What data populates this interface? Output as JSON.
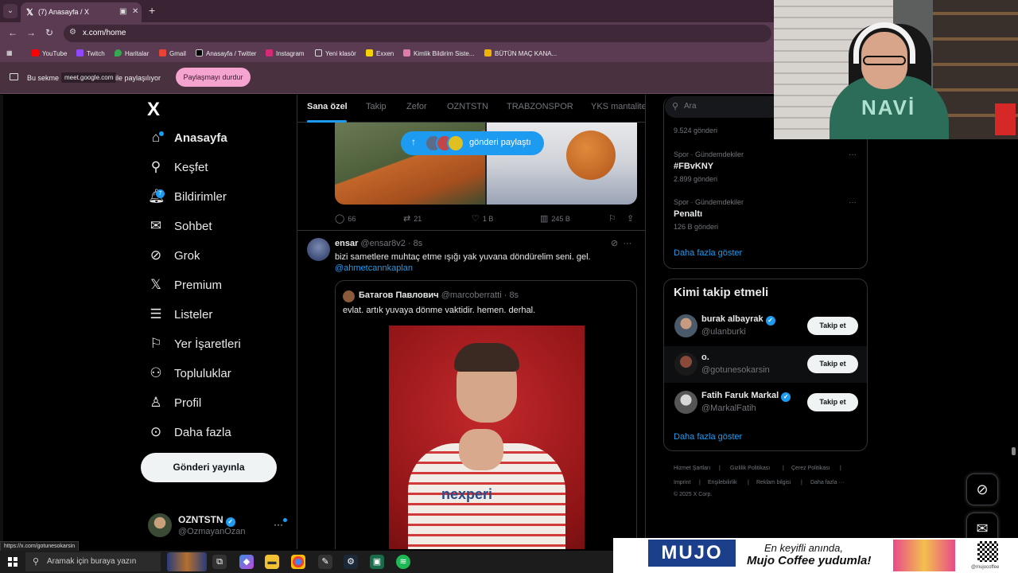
{
  "browser": {
    "tab_title": "(7) Anasayfa / X",
    "url": "x.com/home",
    "bookmarks": [
      "YouTube",
      "Twitch",
      "Haritalar",
      "Gmail",
      "Anasayfa / Twitter",
      "Instagram",
      "Yeni klasör",
      "Exxen",
      "Kimlik Bildirim Siste...",
      "BÜTÜN MAÇ KANA..."
    ],
    "share_bar": {
      "prefix": "Bu sekme",
      "site": "meet.google.com",
      "suffix": "ile paylaşılıyor",
      "stop_button": "Paylaşmayı durdur"
    },
    "status_url": "https://x.com/gotunesokarsin"
  },
  "sidebar": {
    "logo": "X",
    "notif_count": "7",
    "items": [
      {
        "label": "Anasayfa",
        "icon": "home-icon"
      },
      {
        "label": "Keşfet",
        "icon": "search-icon"
      },
      {
        "label": "Bildirimler",
        "icon": "bell-icon"
      },
      {
        "label": "Sohbet",
        "icon": "mail-icon"
      },
      {
        "label": "Grok",
        "icon": "grok-icon"
      },
      {
        "label": "Premium",
        "icon": "x-icon"
      },
      {
        "label": "Listeler",
        "icon": "list-icon"
      },
      {
        "label": "Yer İşaretleri",
        "icon": "bookmark-icon"
      },
      {
        "label": "Topluluklar",
        "icon": "people-icon"
      },
      {
        "label": "Profil",
        "icon": "user-icon"
      },
      {
        "label": "Daha fazla",
        "icon": "more-circle-icon"
      }
    ],
    "post_button": "Gönderi yayınla",
    "account": {
      "name": "OZNTSTN",
      "handle": "@OzmayanOzan",
      "more": "···"
    }
  },
  "feed": {
    "tabs": [
      "Sana özel",
      "Takip",
      "Zefor",
      "OZNTSTN",
      "TRABZONSPOR",
      "YKS mantalite"
    ],
    "new_posts_pill": "gönderi paylaştı",
    "post1_actions": {
      "replies": "66",
      "reposts": "21",
      "likes": "1 B",
      "views": "245 B"
    },
    "post2": {
      "name": "ensar",
      "handle": "@ensar8v2",
      "time": "· 8s",
      "text": "bizi sametlere muhtaç etme ışığı yak yuvana döndürelim seni. gel.",
      "mention": "@ahmetcannkaplan",
      "quote": {
        "name": "Батагов Павлович",
        "handle": "@marcoberratti",
        "time": "· 8s",
        "text": "evlat. artık yuvaya dönme vaktidir. hemen. derhal.",
        "image_sponsor": "nexperi"
      }
    }
  },
  "right": {
    "search_placeholder": "Ara",
    "trends": [
      {
        "context": "",
        "title": "",
        "count": "9.524 gönderi"
      },
      {
        "context": "Spor · Gündemdekiler",
        "title": "#FBvKNY",
        "count": "2.899 gönderi"
      },
      {
        "context": "Spor · Gündemdekiler",
        "title": "Penaltı",
        "count": "126 B gönderi"
      }
    ],
    "trends_show_more": "Daha fazla göster",
    "who_to_follow": {
      "title": "Kimi takip etmeli",
      "users": [
        {
          "name": "burak albayrak",
          "handle": "@ulanburki",
          "verified": true,
          "button": "Takip et"
        },
        {
          "name": "o.",
          "handle": "@gotunesokarsin",
          "verified": false,
          "button": "Takip et"
        },
        {
          "name": "Fatih Faruk Markal",
          "handle": "@MarkalFatih",
          "verified": true,
          "button": "Takip et"
        }
      ],
      "show_more": "Daha fazla göster"
    },
    "footer": {
      "row1": [
        "Hizmet Şartları",
        "Gizlilik Politikası",
        "Çerez Politikası"
      ],
      "row2": [
        "Imprint",
        "Erişilebilirlik",
        "Reklam bilgisi",
        "Daha fazla ···"
      ],
      "copyright": "© 2025 X Corp."
    }
  },
  "overlay": {
    "cam_shirt_text": "NAVİ",
    "ad": {
      "logo": "MUJO",
      "line1": "En keyifli anında,",
      "line2": "Mujo Coffee yudumla!",
      "handle": "@mujocoffee"
    }
  },
  "taskbar": {
    "search_placeholder": "Aramak için buraya yazın"
  },
  "colors": {
    "accent": "#1d9bf0",
    "background": "#000000",
    "chrome": "#5a3b52",
    "pill": "#f5a3cf"
  }
}
